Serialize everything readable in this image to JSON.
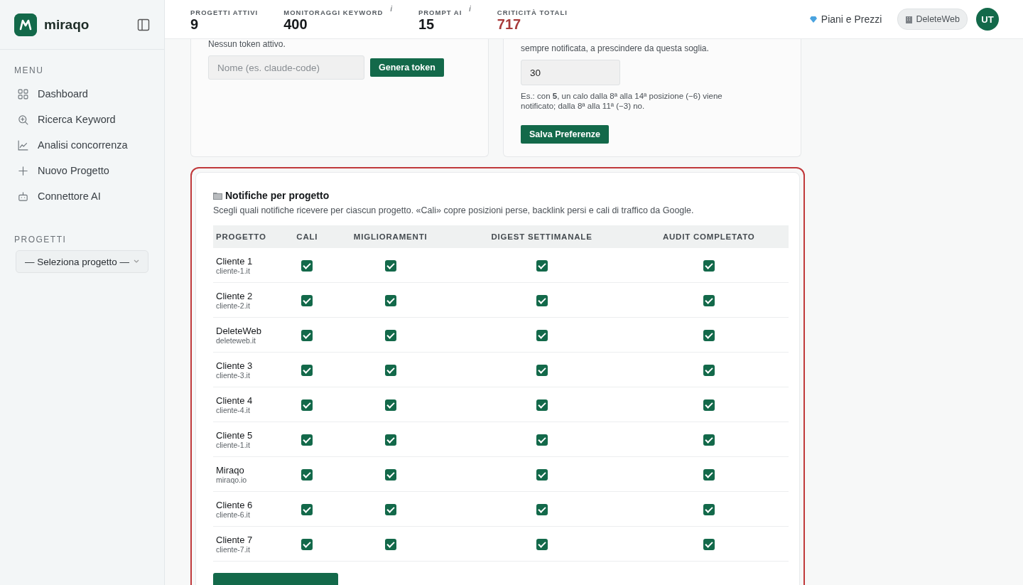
{
  "sidebar": {
    "brand": "miraqo",
    "menu_title": "MENU",
    "items": [
      {
        "label": "Dashboard"
      },
      {
        "label": "Ricerca Keyword"
      },
      {
        "label": "Analisi concorrenza"
      },
      {
        "label": "Nuovo Progetto"
      },
      {
        "label": "Connettore AI"
      }
    ],
    "projects_title": "PROGETTI",
    "project_select": "— Seleziona progetto —"
  },
  "header": {
    "stats": [
      {
        "label": "PROGETTI ATTIVI",
        "value": "9",
        "alert": false
      },
      {
        "label": "MONITORAGGI KEYWORD",
        "value": "400",
        "info": "i",
        "alert": false
      },
      {
        "label": "PROMPT AI",
        "value": "15",
        "info": "i",
        "alert": false
      },
      {
        "label": "CRITICITÀ TOTALI",
        "value": "717",
        "alert": true
      }
    ],
    "plans_link": "Piani e Prezzi",
    "workspace": "DeleteWeb",
    "avatar": "UT"
  },
  "token_card": {
    "status": "Nessun token attivo.",
    "name_placeholder": "Nome (es. claude-code)",
    "generate_button": "Genera token"
  },
  "threshold_card": {
    "note": "sempre notificata, a prescindere da questa soglia.",
    "value": "30",
    "hint": "Es.: con **5**, un calo dalla 8ª alla 14ª posizione (−6) viene notificato; dalla 8ª alla 11ª (−3) no.",
    "save_button": "Salva Preferenze"
  },
  "notifications": {
    "title": "Notifiche per progetto",
    "description": "Scegli quali notifiche ricevere per ciascun progetto. «Cali» copre posizioni perse, backlink persi e cali di traffico da Google.",
    "columns": [
      "PROGETTO",
      "CALI",
      "MIGLIORAMENTI",
      "DIGEST SETTIMANALE",
      "AUDIT COMPLETATO"
    ],
    "rows": [
      {
        "name": "Cliente 1",
        "domain": "cliente-1.it",
        "checks": [
          true,
          true,
          true,
          true
        ]
      },
      {
        "name": "Cliente 2",
        "domain": "cliente-2.it",
        "checks": [
          true,
          true,
          true,
          true
        ]
      },
      {
        "name": "DeleteWeb",
        "domain": "deleteweb.it",
        "checks": [
          true,
          true,
          true,
          true
        ]
      },
      {
        "name": "Cliente 3",
        "domain": "cliente-3.it",
        "checks": [
          true,
          true,
          true,
          true
        ]
      },
      {
        "name": "Cliente 4",
        "domain": "cliente-4.it",
        "checks": [
          true,
          true,
          true,
          true
        ]
      },
      {
        "name": "Cliente 5",
        "domain": "cliente-1.it",
        "checks": [
          true,
          true,
          true,
          true
        ]
      },
      {
        "name": "Miraqo",
        "domain": "miraqo.io",
        "checks": [
          true,
          true,
          true,
          true
        ]
      },
      {
        "name": "Cliente 6",
        "domain": "cliente-6.it",
        "checks": [
          true,
          true,
          true,
          true
        ]
      },
      {
        "name": "Cliente 7",
        "domain": "cliente-7.it",
        "checks": [
          true,
          true,
          true,
          true
        ]
      }
    ]
  }
}
